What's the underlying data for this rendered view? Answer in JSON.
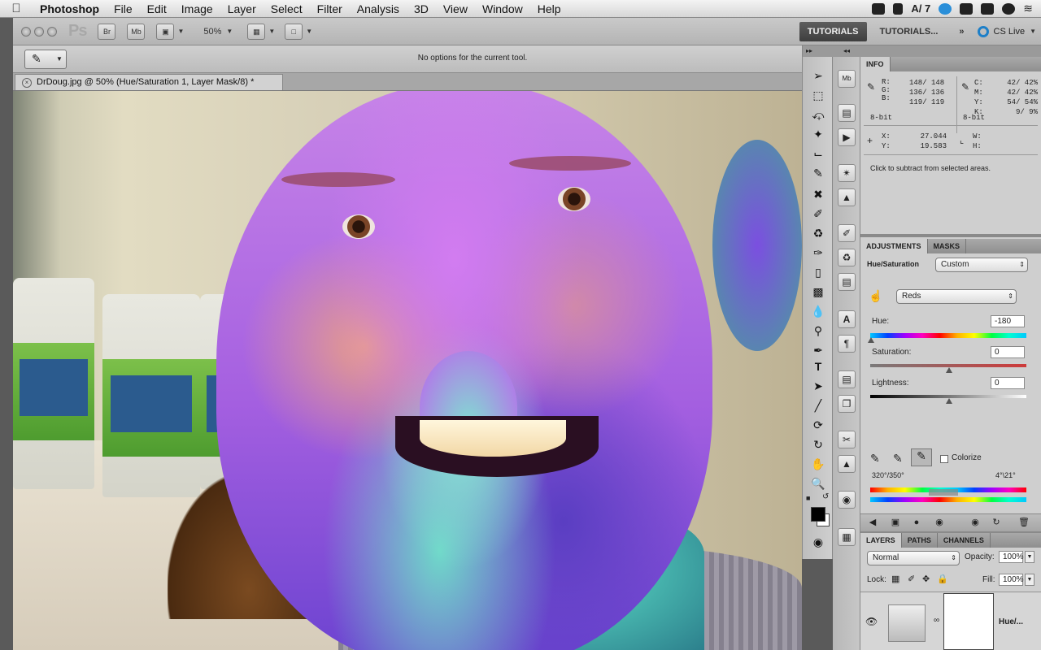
{
  "menubar": {
    "items": [
      "Photoshop",
      "File",
      "Edit",
      "Image",
      "Layer",
      "Select",
      "Filter",
      "Analysis",
      "3D",
      "View",
      "Window",
      "Help"
    ],
    "status_badge": "7"
  },
  "appbar": {
    "bridge": "Br",
    "mini_bridge": "Mb",
    "zoom": "50%",
    "workspace_active": "TUTORIALS",
    "workspace_other": "TUTORIALS...",
    "overflow": "»",
    "cs_live": "CS Live"
  },
  "options": {
    "text": "No options for the current tool."
  },
  "document": {
    "tab_title": "DrDoug.jpg @ 50% (Hue/Saturation 1, Layer Mask/8) *"
  },
  "info_panel": {
    "tab": "INFO",
    "r": "148/ 148",
    "g": "136/ 136",
    "b": "119/ 119",
    "c": "42/ 42%",
    "m": "42/ 42%",
    "y": "54/ 54%",
    "k": "9/ 9%",
    "bitdepth_left": "8-bit",
    "bitdepth_right": "8-bit",
    "x": "27.044",
    "y_coord": "19.583",
    "w": "W:",
    "h": "H:",
    "hint": "Click to subtract from selected areas."
  },
  "adjustments": {
    "tab_adjustments": "ADJUSTMENTS",
    "tab_masks": "MASKS",
    "type_label": "Hue/Saturation",
    "preset": "Custom",
    "channel": "Reds",
    "hue_label": "Hue:",
    "hue_value": "-180",
    "sat_label": "Saturation:",
    "sat_value": "0",
    "light_label": "Lightness:",
    "light_value": "0",
    "colorize": "Colorize",
    "range_left": "320°/350°",
    "range_right": "4°\\21°"
  },
  "layers": {
    "tab_layers": "LAYERS",
    "tab_paths": "PATHS",
    "tab_channels": "CHANNELS",
    "blend_mode": "Normal",
    "opacity_label": "Opacity:",
    "opacity_value": "100%",
    "lock_label": "Lock:",
    "fill_label": "Fill:",
    "fill_value": "100%",
    "layer_name": "Hue/..."
  }
}
